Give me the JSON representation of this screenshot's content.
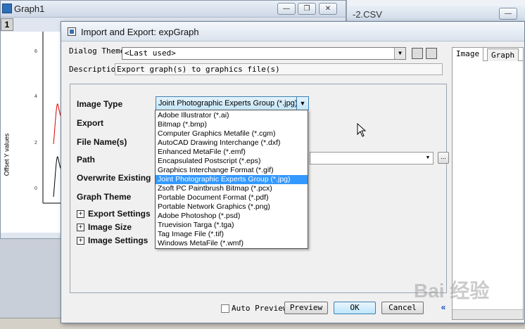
{
  "graph_window": {
    "title": "Graph1",
    "page_number": "1",
    "y_axis_label": "Offset Y values",
    "y_ticks": [
      "6",
      "4",
      "2",
      "0"
    ]
  },
  "csv_window": {
    "title": "-2.CSV"
  },
  "dialog": {
    "title": "Import and Export: expGraph",
    "dialog_theme_label": "Dialog Theme",
    "dialog_theme_value": "<Last used>",
    "description_label": "Descriptio",
    "description_value": "Export graph(s) to graphics file(s)",
    "options": {
      "image_type_label": "Image Type",
      "export_label": "Export",
      "file_names_label": "File Name(s)",
      "path_label": "Path",
      "overwrite_label": "Overwrite Existing",
      "graph_theme_label": "Graph Theme",
      "export_settings_label": "Export Settings",
      "image_size_label": "Image Size",
      "image_settings_label": "Image Settings"
    },
    "image_type_selected": "Joint Photographic Experts Group (*.jpg)",
    "image_type_options": [
      "Adobe Illustrator (*.ai)",
      "Bitmap (*.bmp)",
      "Computer Graphics Metafile (*.cgm)",
      "AutoCAD Drawing Interchange (*.dxf)",
      "Enhanced MetaFile (*.emf)",
      "Encapsulated Postscript (*.eps)",
      "Graphics Interchange Format (*.gif)",
      "Joint Photographic Experts Group (*.jpg)",
      "Zsoft PC Paintbrush Bitmap (*.pcx)",
      "Portable Document Format (*.pdf)",
      "Portable Network Graphics (*.png)",
      "Adobe Photoshop (*.psd)",
      "Truevision Targa (*.tga)",
      "Tag Image File (*.tif)",
      "Windows MetaFile (*.wmf)"
    ],
    "browse_label": "...",
    "auto_preview_label": "Auto Preview",
    "preview_label": "Preview",
    "ok_label": "OK",
    "cancel_label": "Cancel",
    "collapse_label": "«",
    "tabs": {
      "image": "Image",
      "graph": "Graph"
    }
  },
  "watermark": "Bai 经验",
  "colors": {
    "selection": "#3399ff",
    "accent_border": "#3c7fb1"
  }
}
